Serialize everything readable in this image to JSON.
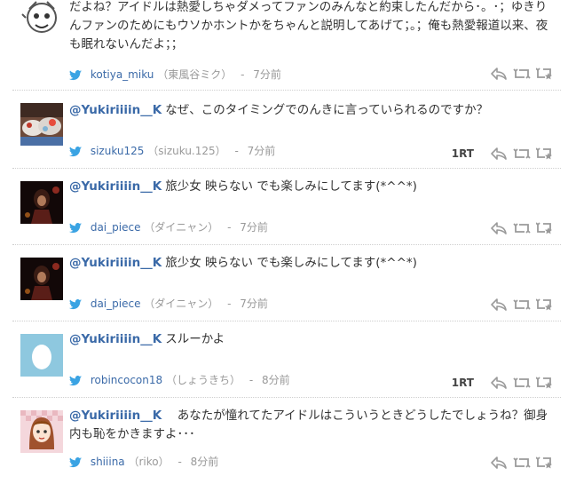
{
  "tweets": [
    {
      "body": "だよね？アイドルは熱愛しちゃダメってファンのみんなと約束したんだから･。･；ゆきりんファンのためにもウソかホントかをちゃんと説明してあげて；。；俺も熱愛報道以来、夜も眠れないんだよ；；",
      "mention": "",
      "user": "kotiya_miku",
      "display_name": "（東風谷ミク）",
      "sep": "-",
      "time": "7分前",
      "rt_count": "",
      "avatar_icon": "comic-face-avatar"
    },
    {
      "mention": "@Yukiriiiin__K",
      "body": "なぜ、このタイミングでのんきに言っていられるのですか？",
      "user": "sizuku125",
      "display_name": "（sizuku.125）",
      "sep": "-",
      "time": "7分前",
      "rt_count": "1RT",
      "avatar_icon": "dessert-photo-avatar"
    },
    {
      "mention": "@Yukiriiiin__K",
      "body": "旅少女 映らない でも楽しみにしてます(*^^*)",
      "user": "dai_piece",
      "display_name": "（ダイニャン）",
      "sep": "-",
      "time": "7分前",
      "rt_count": "",
      "avatar_icon": "stage-performer-avatar"
    },
    {
      "mention": "@Yukiriiiin__K",
      "body": "旅少女 映らない でも楽しみにしてます(*^^*)",
      "user": "dai_piece",
      "display_name": "（ダイニャン）",
      "sep": "-",
      "time": "7分前",
      "rt_count": "",
      "avatar_icon": "stage-performer-avatar"
    },
    {
      "mention": "@Yukiriiiin__K",
      "body": "スルーかよ",
      "user": "robincocon18",
      "display_name": "（しょうきち）",
      "sep": "-",
      "time": "8分前",
      "rt_count": "1RT",
      "avatar_icon": "default-egg-avatar"
    },
    {
      "mention": "@Yukiriiiin__K",
      "body": "　あなたが憧れてたアイドルはこういうときどうしたでしょうね？御身内も恥をかきますよ･･･",
      "user": "shiiina",
      "display_name": "（riko）",
      "sep": "-",
      "time": "8分前",
      "rt_count": "",
      "avatar_icon": "anime-girl-avatar"
    }
  ],
  "colors": {
    "mention": "#3b6aa8",
    "link": "#3b6aa8",
    "meta": "#999999",
    "twitter_bird": "#3aa3e3",
    "action_icon": "#9a9a9a"
  }
}
